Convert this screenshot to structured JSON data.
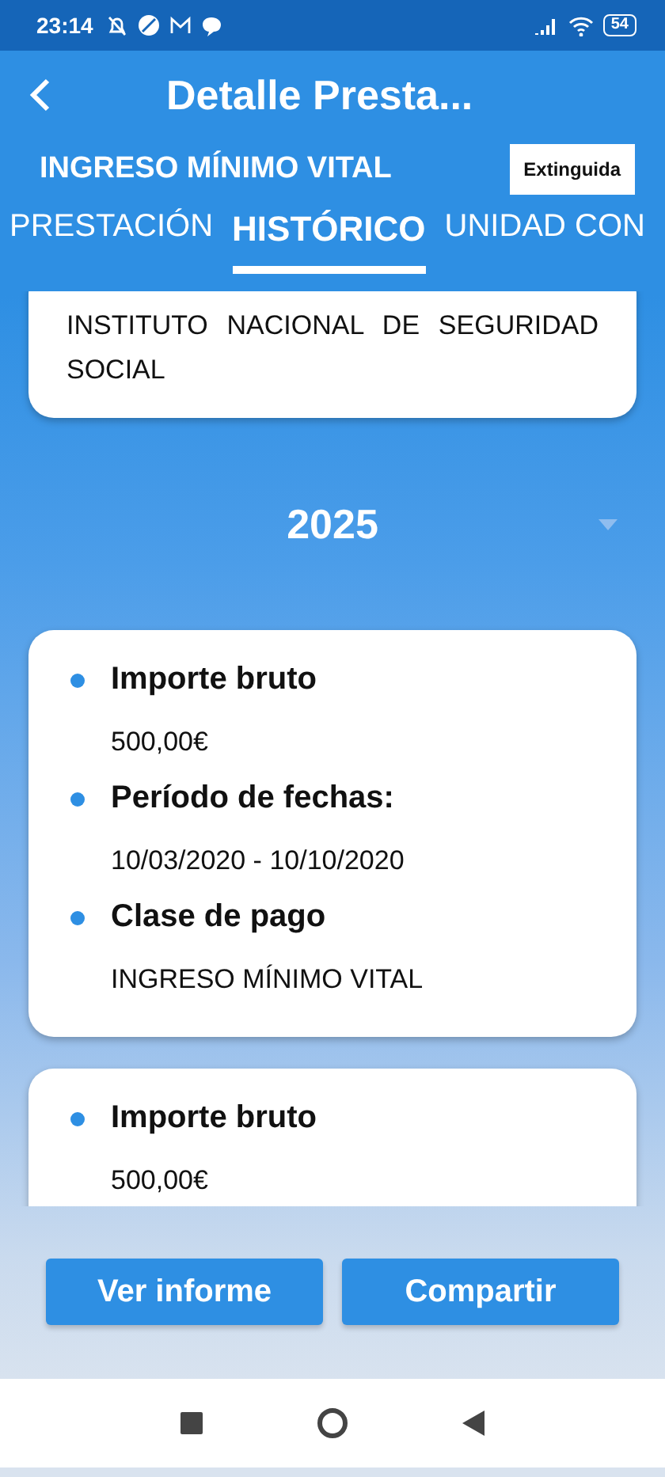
{
  "status_bar": {
    "time": "23:14",
    "battery": "54"
  },
  "header": {
    "title": "Detalle Presta...",
    "subtitle": "INGRESO MÍNIMO VITAL",
    "badge": "Extinguida"
  },
  "tabs": [
    {
      "label": "PRESTACIÓN",
      "selected": false
    },
    {
      "label": "HISTÓRICO",
      "selected": true
    },
    {
      "label": "UNIDAD CON",
      "selected": false
    }
  ],
  "entity_card": {
    "text": "INSTITUTO NACIONAL DE SEGURIDAD SOCIAL"
  },
  "year_select": {
    "value": "2025"
  },
  "records": [
    {
      "items": [
        {
          "label": "Importe bruto",
          "value": "500,00€"
        },
        {
          "label": "Período de fechas:",
          "value": "10/03/2020 - 10/10/2020"
        },
        {
          "label": "Clase de pago",
          "value": "INGRESO MÍNIMO VITAL"
        }
      ]
    },
    {
      "items": [
        {
          "label": "Importe bruto",
          "value": "500,00€"
        }
      ]
    }
  ],
  "buttons": [
    "Ver informe",
    "Compartir"
  ]
}
